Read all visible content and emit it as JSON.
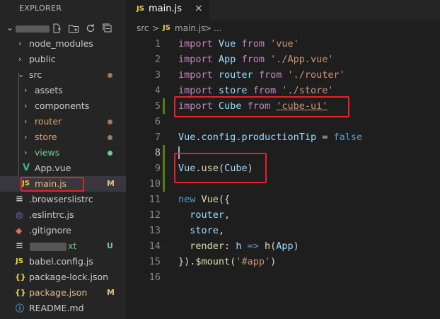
{
  "explorer": {
    "title": "EXPLORER",
    "tree": [
      {
        "label": "node_modules",
        "kind": "folder",
        "expanded": false,
        "depth": 1
      },
      {
        "label": "public",
        "kind": "folder",
        "expanded": false,
        "depth": 1
      },
      {
        "label": "src",
        "kind": "folder",
        "expanded": true,
        "depth": 1,
        "status": "modified-dot"
      },
      {
        "label": "assets",
        "kind": "folder",
        "expanded": false,
        "depth": 2
      },
      {
        "label": "components",
        "kind": "folder",
        "expanded": false,
        "depth": 2
      },
      {
        "label": "router",
        "kind": "folder",
        "expanded": false,
        "depth": 2,
        "status": "modified-dot"
      },
      {
        "label": "store",
        "kind": "folder",
        "expanded": false,
        "depth": 2,
        "status": "modified-dot"
      },
      {
        "label": "views",
        "kind": "folder",
        "expanded": false,
        "depth": 2,
        "status": "untracked-dot"
      },
      {
        "label": "App.vue",
        "kind": "vue-file",
        "depth": 2
      },
      {
        "label": "main.js",
        "kind": "js-file",
        "depth": 2,
        "badge": "M",
        "selected": true
      },
      {
        "label": ".browserslistrc",
        "kind": "config-file",
        "depth": 1
      },
      {
        "label": ".eslintrc.js",
        "kind": "eslint-file",
        "depth": 1
      },
      {
        "label": ".gitignore",
        "kind": "git-file",
        "depth": 1
      },
      {
        "label": "xt",
        "kind": "text-file",
        "depth": 1,
        "badge": "U"
      },
      {
        "label": "babel.config.js",
        "kind": "js-file",
        "depth": 1
      },
      {
        "label": "package-lock.json",
        "kind": "json-file",
        "depth": 1
      },
      {
        "label": "package.json",
        "kind": "json-file",
        "depth": 1,
        "badge": "M"
      },
      {
        "label": "README.md",
        "kind": "info-file",
        "depth": 1
      }
    ]
  },
  "editor": {
    "tab": {
      "icon_text": "JS",
      "label": "main.js",
      "close": "×"
    },
    "breadcrumb": {
      "folder": "src",
      "sep1": ">",
      "icon_text": "JS",
      "file": "main.js",
      "sep2": ">",
      "more": "..."
    },
    "lines": [
      {
        "n": "1",
        "tokens": [
          [
            "kw",
            "import"
          ],
          [
            "dim",
            " "
          ],
          [
            "id",
            "Vue"
          ],
          [
            "dim",
            " "
          ],
          [
            "kw",
            "from"
          ],
          [
            "dim",
            " "
          ],
          [
            "str",
            "'vue'"
          ]
        ]
      },
      {
        "n": "2",
        "tokens": [
          [
            "kw",
            "import"
          ],
          [
            "dim",
            " "
          ],
          [
            "id",
            "App"
          ],
          [
            "dim",
            " "
          ],
          [
            "kw",
            "from"
          ],
          [
            "dim",
            " "
          ],
          [
            "str",
            "'./App.vue'"
          ]
        ]
      },
      {
        "n": "3",
        "tokens": [
          [
            "kw",
            "import"
          ],
          [
            "dim",
            " "
          ],
          [
            "id",
            "router"
          ],
          [
            "dim",
            " "
          ],
          [
            "kw",
            "from"
          ],
          [
            "dim",
            " "
          ],
          [
            "str",
            "'./router'"
          ]
        ]
      },
      {
        "n": "4",
        "tokens": [
          [
            "kw",
            "import"
          ],
          [
            "dim",
            " "
          ],
          [
            "id",
            "store"
          ],
          [
            "dim",
            " "
          ],
          [
            "kw",
            "from"
          ],
          [
            "dim",
            " "
          ],
          [
            "str",
            "'./store'"
          ]
        ]
      },
      {
        "n": "5",
        "tokens": [
          [
            "kw",
            "import"
          ],
          [
            "dim",
            " "
          ],
          [
            "id",
            "Cube"
          ],
          [
            "dim",
            " "
          ],
          [
            "kw",
            "from"
          ],
          [
            "dim",
            " "
          ],
          [
            "link",
            "'cube-ui'"
          ]
        ]
      },
      {
        "n": "6",
        "tokens": []
      },
      {
        "n": "7",
        "tokens": [
          [
            "id",
            "Vue"
          ],
          [
            "dim",
            "."
          ],
          [
            "id",
            "config"
          ],
          [
            "dim",
            "."
          ],
          [
            "id",
            "productionTip"
          ],
          [
            "dim",
            " = "
          ],
          [
            "bool",
            "false"
          ]
        ]
      },
      {
        "n": "8",
        "tokens": []
      },
      {
        "n": "9",
        "tokens": [
          [
            "id",
            "Vue"
          ],
          [
            "dim",
            "."
          ],
          [
            "fn",
            "use"
          ],
          [
            "dim",
            "("
          ],
          [
            "id",
            "Cube"
          ],
          [
            "dim",
            ")"
          ]
        ]
      },
      {
        "n": "10",
        "tokens": []
      },
      {
        "n": "11",
        "tokens": [
          [
            "bool",
            "new"
          ],
          [
            "dim",
            " "
          ],
          [
            "fn",
            "Vue"
          ],
          [
            "dim",
            "({"
          ]
        ]
      },
      {
        "n": "12",
        "tokens": [
          [
            "dim",
            "  "
          ],
          [
            "id",
            "router"
          ],
          [
            "dim",
            ","
          ]
        ]
      },
      {
        "n": "13",
        "tokens": [
          [
            "dim",
            "  "
          ],
          [
            "id",
            "store"
          ],
          [
            "dim",
            ","
          ]
        ]
      },
      {
        "n": "14",
        "tokens": [
          [
            "dim",
            "  "
          ],
          [
            "fn",
            "render"
          ],
          [
            "dim",
            ": "
          ],
          [
            "id",
            "h"
          ],
          [
            "dim",
            " "
          ],
          [
            "bool",
            "=>"
          ],
          [
            "dim",
            " "
          ],
          [
            "fn",
            "h"
          ],
          [
            "dim",
            "("
          ],
          [
            "id",
            "App"
          ],
          [
            "dim",
            ")"
          ]
        ]
      },
      {
        "n": "15",
        "tokens": [
          [
            "dim",
            "})."
          ],
          [
            "fn",
            "$mount"
          ],
          [
            "dim",
            "("
          ],
          [
            "str",
            "'#app'"
          ],
          [
            "dim",
            ")"
          ]
        ]
      },
      {
        "n": "16",
        "tokens": []
      }
    ]
  },
  "colors": {
    "highlight_box": "#e8212b",
    "modified_dot": "#a07b5a",
    "untracked_dot": "#73c991",
    "badge_modified": "#e2c08d",
    "badge_untracked": "#73c991"
  }
}
